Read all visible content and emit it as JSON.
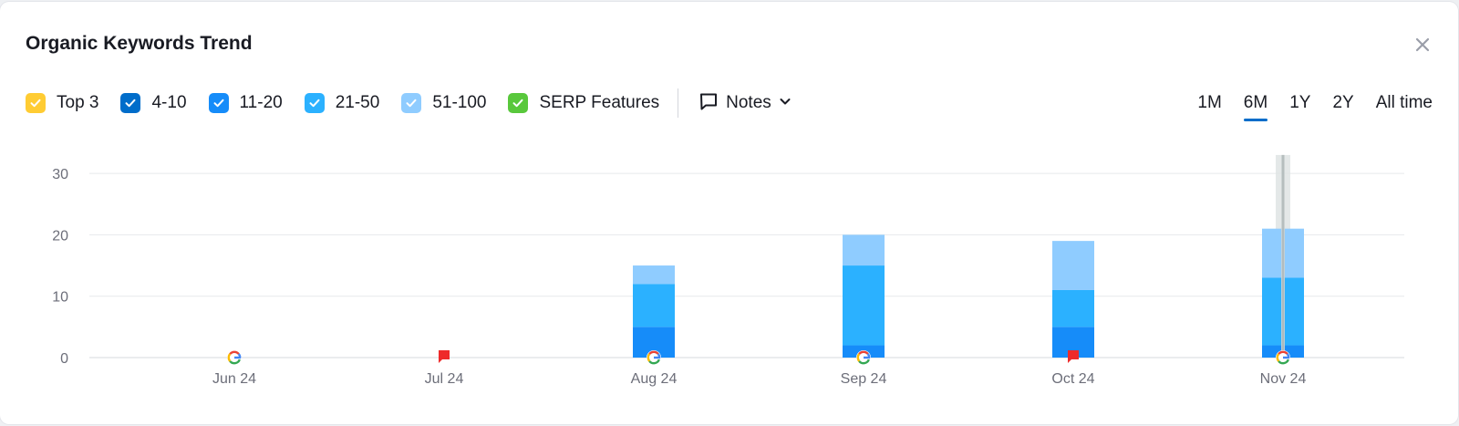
{
  "widget": {
    "title": "Organic Keywords Trend"
  },
  "legend": [
    {
      "label": "Top 3",
      "color": "#ffcc33",
      "checked": true
    },
    {
      "label": "4-10",
      "color": "#006dca",
      "checked": true
    },
    {
      "label": "11-20",
      "color": "#168cf9",
      "checked": true
    },
    {
      "label": "21-50",
      "color": "#2bb1ff",
      "checked": true
    },
    {
      "label": "51-100",
      "color": "#8fccff",
      "checked": true
    },
    {
      "label": "SERP Features",
      "color": "#59c83c",
      "checked": true
    }
  ],
  "notes": {
    "label": "Notes",
    "icon": "comment-icon"
  },
  "range_tabs": [
    {
      "label": "1M",
      "active": false
    },
    {
      "label": "6M",
      "active": true
    },
    {
      "label": "1Y",
      "active": false
    },
    {
      "label": "2Y",
      "active": false
    },
    {
      "label": "All time",
      "active": false
    }
  ],
  "chart_data": {
    "type": "bar",
    "stacked": true,
    "categories": [
      "Jun 24",
      "Jul 24",
      "Aug 24",
      "Sep 24",
      "Oct 24",
      "Nov 24"
    ],
    "series": [
      {
        "name": "Top 3",
        "values": [
          0,
          0,
          0,
          0,
          0,
          0
        ],
        "color": "#ffcc33"
      },
      {
        "name": "4-10",
        "values": [
          0,
          0,
          0,
          0,
          0,
          0
        ],
        "color": "#006dca"
      },
      {
        "name": "11-20",
        "values": [
          0,
          0,
          5,
          2,
          5,
          2
        ],
        "color": "#168cf9"
      },
      {
        "name": "21-50",
        "values": [
          0,
          0,
          7,
          13,
          6,
          11
        ],
        "color": "#2bb1ff"
      },
      {
        "name": "51-100",
        "values": [
          0,
          0,
          3,
          5,
          8,
          8
        ],
        "color": "#8fccff"
      }
    ],
    "yticks": [
      0,
      10,
      20,
      30
    ],
    "ylim": [
      0,
      33
    ],
    "grid": true,
    "markers": [
      "google",
      "flag",
      "google",
      "google",
      "flag",
      "google"
    ],
    "hover_category": "Nov 24"
  }
}
